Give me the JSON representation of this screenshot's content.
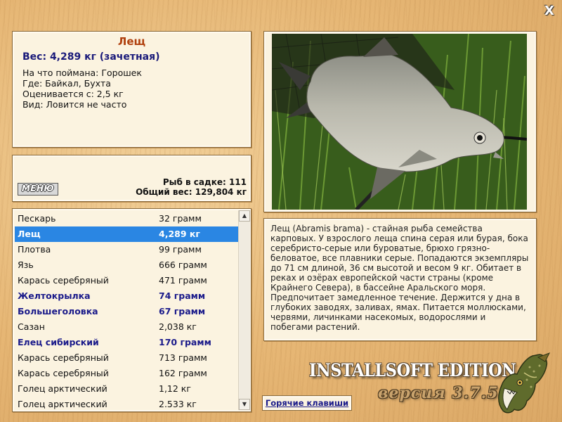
{
  "window": {
    "close_glyph": "X"
  },
  "info": {
    "title": "Лещ",
    "weight": "Вес: 4,289 кг (зачетная)",
    "lines": [
      "На что поймана: Горошек",
      "Где: Байкал, Бухта",
      "Оценивается с: 2,5 кг",
      "Вид: Ловится не часто"
    ]
  },
  "sack": {
    "menu_label": "МЕНЮ",
    "count": "Рыб в садке: 111",
    "total_weight": "Общий вес: 129,804 кг"
  },
  "catch_list": [
    {
      "name": "Пескарь",
      "weight": "32 грамм",
      "bold": false,
      "selected": false
    },
    {
      "name": "Лещ",
      "weight": "4,289 кг",
      "bold": true,
      "selected": true
    },
    {
      "name": "Плотва",
      "weight": "99 грамм",
      "bold": false,
      "selected": false
    },
    {
      "name": "Язь",
      "weight": "666 грамм",
      "bold": false,
      "selected": false
    },
    {
      "name": "Карась серебряный",
      "weight": "471 грамм",
      "bold": false,
      "selected": false
    },
    {
      "name": "Желтокрылка",
      "weight": "74 грамм",
      "bold": true,
      "selected": false
    },
    {
      "name": "Большеголовка",
      "weight": "67 грамм",
      "bold": true,
      "selected": false
    },
    {
      "name": "Сазан",
      "weight": "2,038 кг",
      "bold": false,
      "selected": false
    },
    {
      "name": "Елец сибирский",
      "weight": "170 грамм",
      "bold": true,
      "selected": false
    },
    {
      "name": "Карась серебряный",
      "weight": "713 грамм",
      "bold": false,
      "selected": false
    },
    {
      "name": "Карась серебряный",
      "weight": "162 грамм",
      "bold": false,
      "selected": false
    },
    {
      "name": "Голец арктический",
      "weight": "1,12 кг",
      "bold": false,
      "selected": false
    },
    {
      "name": "Голец арктический",
      "weight": "2.533 кг",
      "bold": false,
      "selected": false
    }
  ],
  "description": "Лещ (Abramis brama) - стайная рыба семейства карповых. У взрослого леща спина серая или бурая, бока серебристо-серые или буроватые, брюхо грязно-беловатое, все плавники серые. Попадаются экземпляры до 71 см длиной, 36 см высотой и весом 9 кг. Обитает в реках и озёрах европейской части страны (кроме Крайнего Севера), в бассейне Аральского моря. Предпочитает замедленное течение. Держится у дна в глубоких заводях, заливах, ямах. Питается моллюсками, червями, личинками насекомых, водорослями и побегами растений.",
  "footer": {
    "hotkeys_label": "Горячие клавиши",
    "edition": "INSTALLSOFT EDITION",
    "version": "версия 3.7.5"
  },
  "colors": {
    "selected_row": "#2a86e3",
    "bold_fish": "#1a1a8a",
    "title": "#b0400e"
  },
  "icons": {
    "close": "close-icon",
    "scroll_up": "arrow-up-icon",
    "scroll_down": "arrow-down-icon",
    "logo": "pike-fish-logo"
  }
}
